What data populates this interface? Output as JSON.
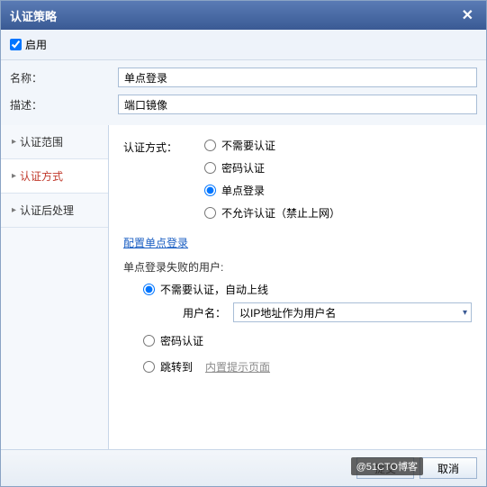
{
  "dialog": {
    "title": "认证策略",
    "close": "✕"
  },
  "enable": {
    "label": "启用",
    "checked": true
  },
  "form": {
    "name_label": "名称：",
    "name_value": "单点登录",
    "desc_label": "描述：",
    "desc_value": "端口镜像"
  },
  "sidebar": {
    "items": [
      {
        "label": "认证范围"
      },
      {
        "label": "认证方式"
      },
      {
        "label": "认证后处理"
      }
    ],
    "chev": "▸"
  },
  "content": {
    "auth_method_label": "认证方式：",
    "auth_methods": [
      {
        "label": "不需要认证",
        "checked": false
      },
      {
        "label": "密码认证",
        "checked": false
      },
      {
        "label": "单点登录",
        "checked": true
      },
      {
        "label": "不允许认证（禁止上网）",
        "checked": false
      }
    ],
    "config_link": "配置单点登录",
    "fail_user_title": "单点登录失败的用户:",
    "fail_options": [
      {
        "label": "不需要认证，自动上线",
        "checked": true
      },
      {
        "label": "密码认证",
        "checked": false
      },
      {
        "label": "跳转到",
        "checked": false
      }
    ],
    "username_label": "用户名：",
    "username_select": "以IP地址作为用户名",
    "redirect_link": "内置提示页面"
  },
  "footer": {
    "submit": "提交",
    "cancel": "取消",
    "watermark": "@51CTO博客"
  }
}
